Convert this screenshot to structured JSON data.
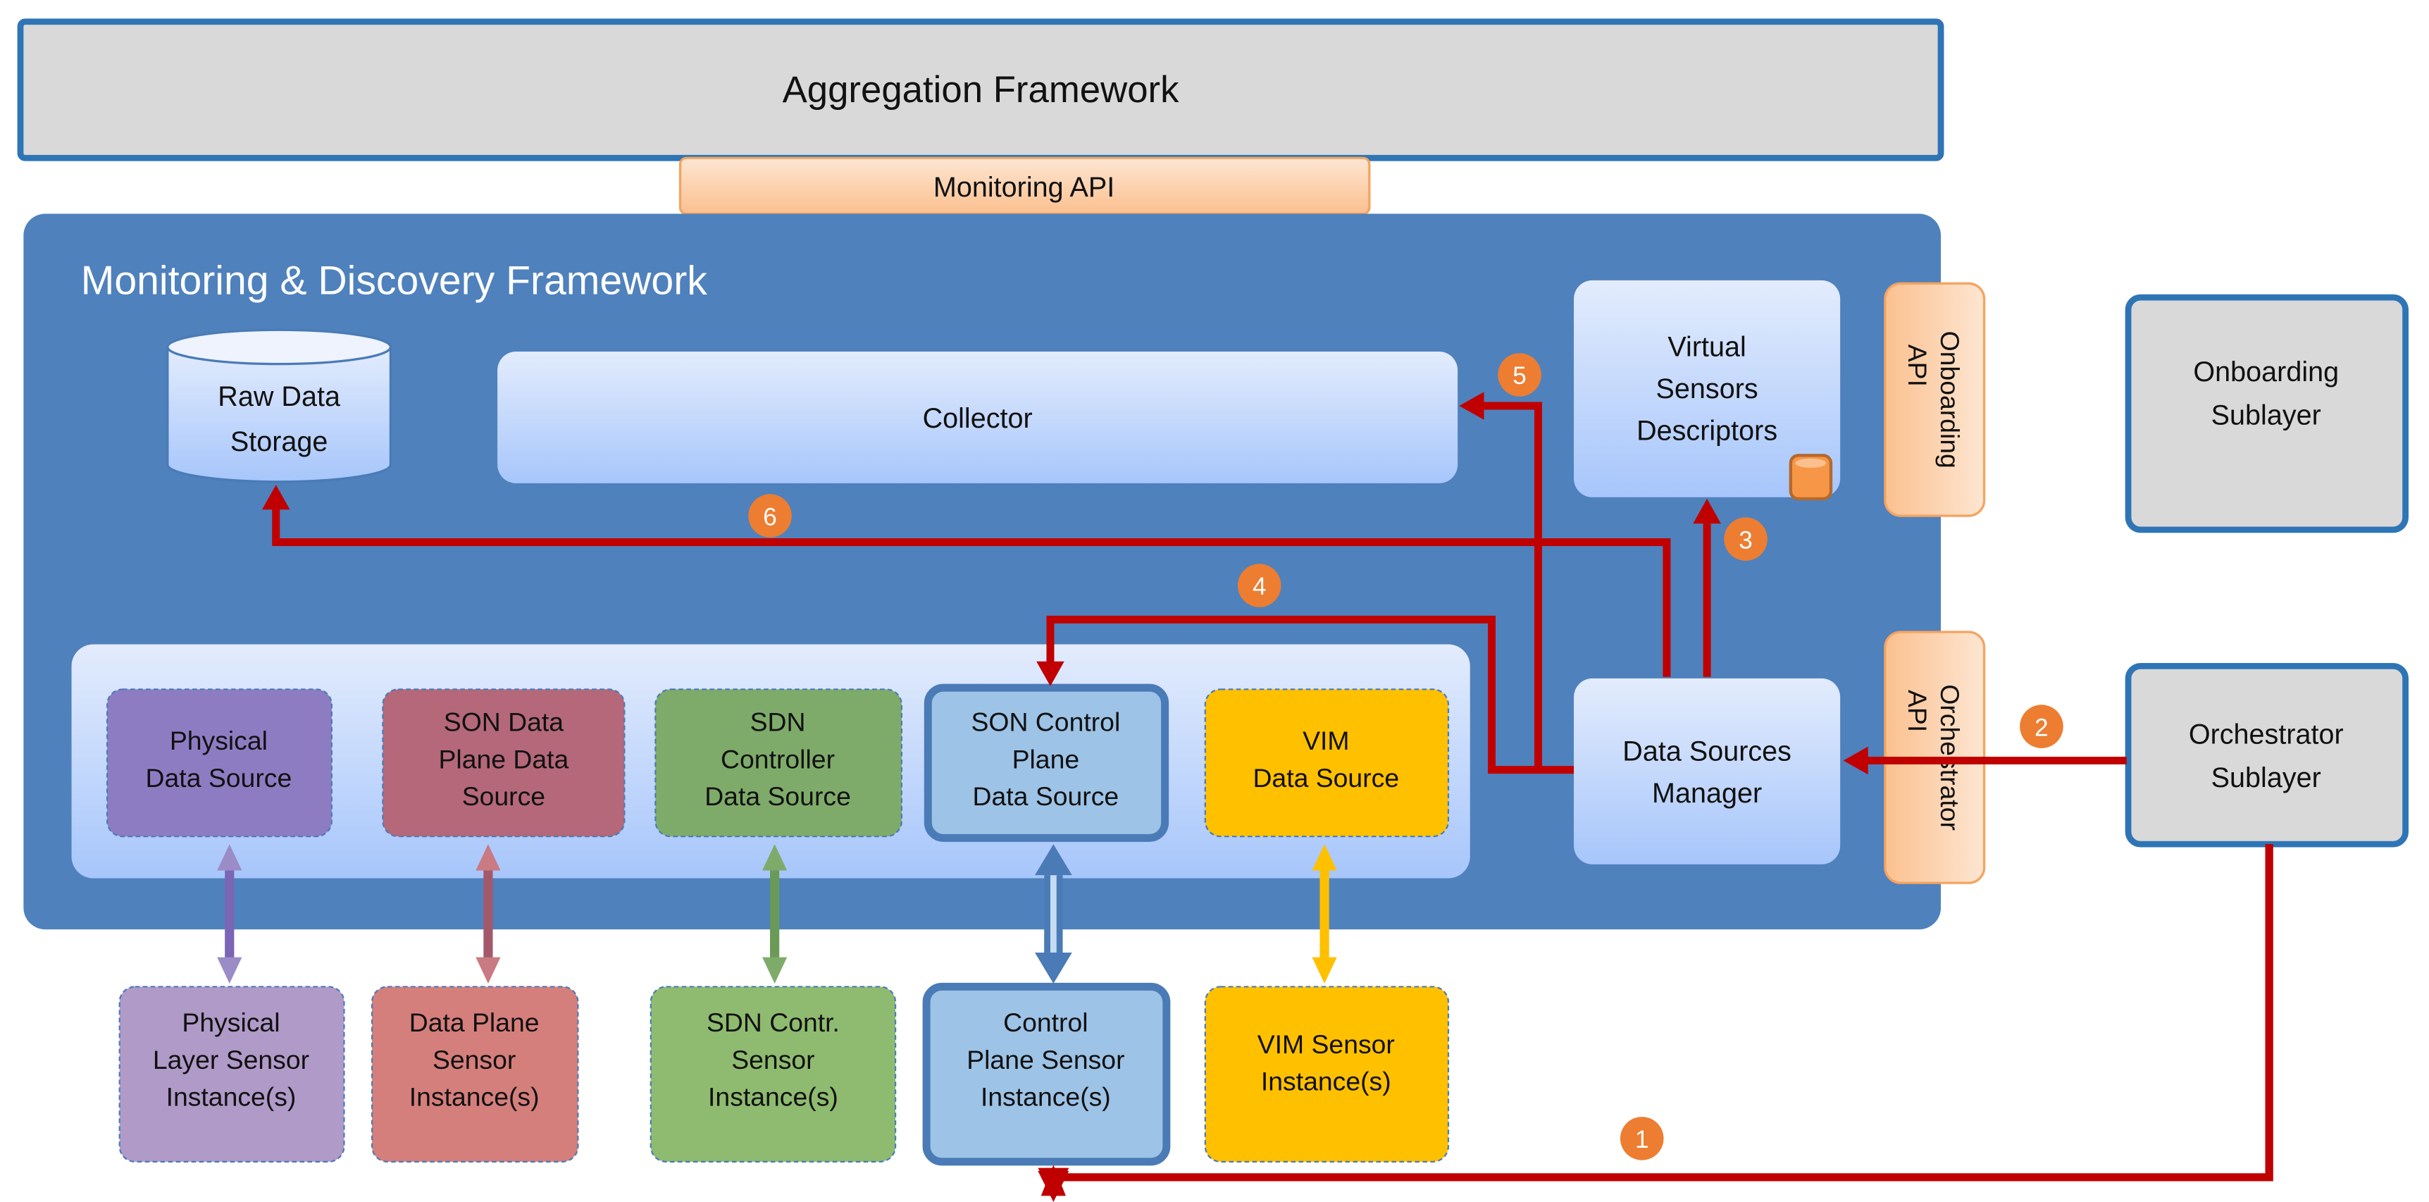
{
  "aggregation": {
    "title": "Aggregation Framework"
  },
  "monitoring_api": {
    "label": "Monitoring  API"
  },
  "framework": {
    "title": "Monitoring & Discovery Framework",
    "raw_storage": [
      "Raw Data",
      "Storage"
    ],
    "collector": "Collector",
    "virtual_sensors": [
      "Virtual",
      "Sensors",
      "Descriptors"
    ],
    "manager": [
      "Data Sources",
      "Manager"
    ],
    "data_sources": [
      {
        "lines": [
          "Physical",
          "Data Source"
        ],
        "color": "#8e7cc3"
      },
      {
        "lines": [
          "SON Data",
          "Plane Data",
          "Source"
        ],
        "color": "#b4687a"
      },
      {
        "lines": [
          "SDN",
          "Controller",
          "Data Source"
        ],
        "color": "#7fab6a"
      },
      {
        "lines": [
          "SON Control",
          "Plane",
          "Data Source"
        ],
        "color": "#9dc3e6"
      },
      {
        "lines": [
          "VIM",
          "Data Source"
        ],
        "color": "#ffc000"
      }
    ]
  },
  "sensors": [
    {
      "lines": [
        "Physical",
        "Layer Sensor",
        "Instance(s)"
      ],
      "color": "#b09ac8"
    },
    {
      "lines": [
        "Data Plane",
        "Sensor",
        "Instance(s)"
      ],
      "color": "#d57f7c"
    },
    {
      "lines": [
        "SDN Contr.",
        "Sensor",
        "Instance(s)"
      ],
      "color": "#8fbb70"
    },
    {
      "lines": [
        "Control",
        "Plane Sensor",
        "Instance(s)"
      ],
      "color": "#9dc3e6"
    },
    {
      "lines": [
        "VIM Sensor",
        "Instance(s)"
      ],
      "color": "#ffc000"
    }
  ],
  "onboarding_api": [
    "Onboarding",
    "API"
  ],
  "orchestrator_api": [
    "Orchestrator",
    "API"
  ],
  "onboarding_sublayer": [
    "Onboarding",
    "Sublayer"
  ],
  "orchestrator_sublayer": [
    "Orchestrator",
    "Sublayer"
  ],
  "steps": [
    "1",
    "2",
    "3",
    "4",
    "5",
    "6"
  ],
  "colors": {
    "framework": "#4f81bd",
    "arrow": "#c00000",
    "badge": "#ed7d31",
    "border": "#2e75b6",
    "gray": "#d9d9d9"
  }
}
